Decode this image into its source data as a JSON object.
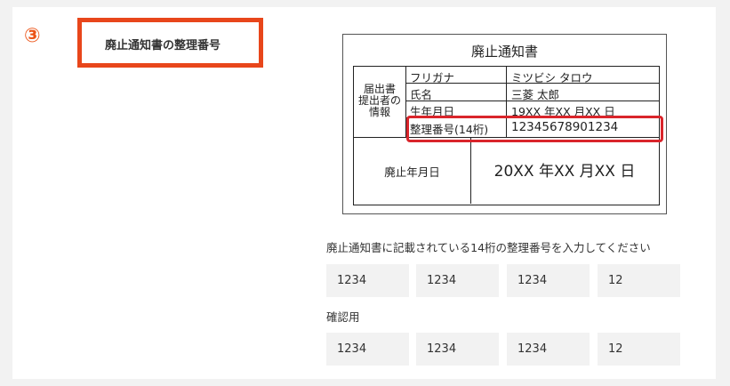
{
  "step": {
    "number": "③",
    "label": "廃止通知書の整理番号"
  },
  "document": {
    "title": "廃止通知書",
    "section_label": [
      "届出書",
      "提出者の",
      "情報"
    ],
    "rows": [
      {
        "field": "フリガナ",
        "value": "ミツビシ タロウ"
      },
      {
        "field": "氏名",
        "value": "三菱 太郎"
      },
      {
        "field": "生年月日",
        "value": "19XX 年XX 月XX 日"
      },
      {
        "field": "整理番号(14桁)",
        "value": "12345678901234"
      }
    ],
    "abolition_label": "廃止年月日",
    "abolition_value": "20XX 年XX 月XX 日"
  },
  "form": {
    "instruction": "廃止通知書に記載されている14桁の整理番号を入力してください",
    "fields": [
      "1234",
      "1234",
      "1234",
      "12"
    ],
    "confirm_label": "確認用",
    "confirm_fields": [
      "1234",
      "1234",
      "1234",
      "12"
    ]
  }
}
